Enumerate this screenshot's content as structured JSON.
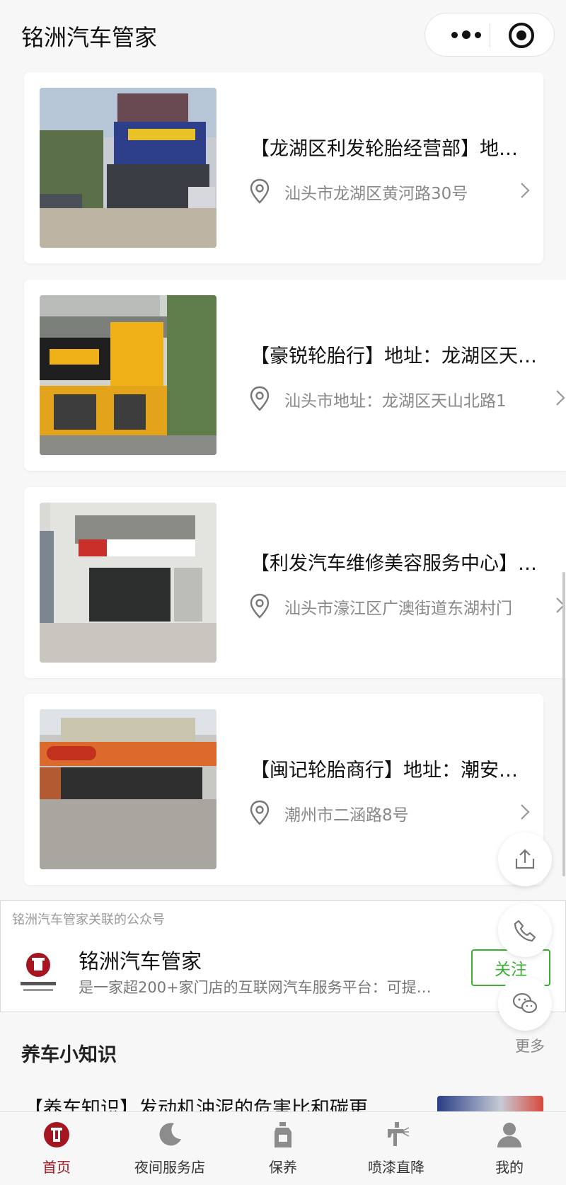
{
  "header": {
    "title": "铭洲汽车管家"
  },
  "stores": [
    {
      "name": "【龙湖区利发轮胎经营部】地…",
      "address": "汕头市龙湖区黄河路30号"
    },
    {
      "name": "【豪锐轮胎行】地址：龙湖区天…",
      "address": "汕头市地址：龙湖区天山北路1"
    },
    {
      "name": "【利发汽车维修美容服务中心】…",
      "address": "汕头市濠江区广澳街道东湖村门"
    },
    {
      "name": "【闽记轮胎商行】地址：潮安…",
      "address": "潮州市二涵路8号"
    }
  ],
  "official": {
    "caption": "铭洲汽车管家关联的公众号",
    "name": "铭洲汽车管家",
    "description": "是一家超200+家门店的互联网汽车服务平台：可提…",
    "follow_label": "关注"
  },
  "floating": {
    "more_label": "更多"
  },
  "knowledge": {
    "title": "养车小知识",
    "first_article": "【养车知识】发动机油泥的危害比和碳更"
  },
  "tabs": [
    {
      "label": "首页",
      "icon": "home-logo-icon",
      "active": true
    },
    {
      "label": "夜间服务店",
      "icon": "moon-icon",
      "active": false
    },
    {
      "label": "保养",
      "icon": "oil-bottle-icon",
      "active": false
    },
    {
      "label": "喷漆直降",
      "icon": "spray-gun-icon",
      "active": false
    },
    {
      "label": "我的",
      "icon": "user-icon",
      "active": false
    }
  ],
  "colors": {
    "accent": "#a5141f",
    "follow_green": "#3cb034",
    "muted_text": "#888888"
  }
}
